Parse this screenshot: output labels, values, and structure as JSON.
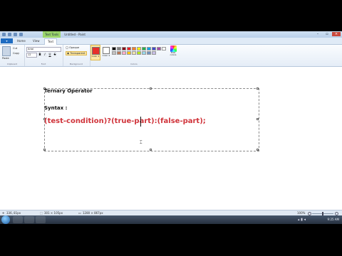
{
  "window": {
    "title_tool_tab": "Text Tools",
    "title": "Untitled - Paint"
  },
  "ribbon": {
    "file_tab": "",
    "tabs": [
      "Home",
      "View",
      "Text"
    ],
    "clipboard": {
      "paste": "Paste",
      "cut": "Cut",
      "copy": "Copy",
      "label": "Clipboard"
    },
    "font": {
      "family": "Arial",
      "size": "12",
      "label": "Font"
    },
    "background": {
      "opaque": "Opaque",
      "transparent": "Transparent",
      "label": "Background"
    },
    "colors": {
      "color1_label": "Color 1",
      "color2_label": "Color 2",
      "color1": "#e8302a",
      "color2": "#ffffff",
      "edit_colors": "Edit colors",
      "label": "Colors",
      "palette": [
        "#000000",
        "#7f7f7f",
        "#880015",
        "#ed1c24",
        "#ff7f27",
        "#fff200",
        "#22b14c",
        "#00a2e8",
        "#3f48cc",
        "#a349a4",
        "#ffffff",
        "#c3c3c3",
        "#b97a57",
        "#ffaec9",
        "#ffc90e",
        "#efe4b0",
        "#b5e61d",
        "#99d9ea",
        "#7092be",
        "#c8bfe7"
      ]
    }
  },
  "document": {
    "heading": "Ternary Operator",
    "syntax_label": "Syntax :",
    "code": "(test-condition)?(true-part):(false-part);"
  },
  "statusbar": {
    "cursor_pos": "336, 81px",
    "selection_size": "301 × 105px",
    "image_size": "1280 × 867px",
    "zoom": "100%"
  },
  "taskbar": {
    "clock": "9:25 AM"
  }
}
